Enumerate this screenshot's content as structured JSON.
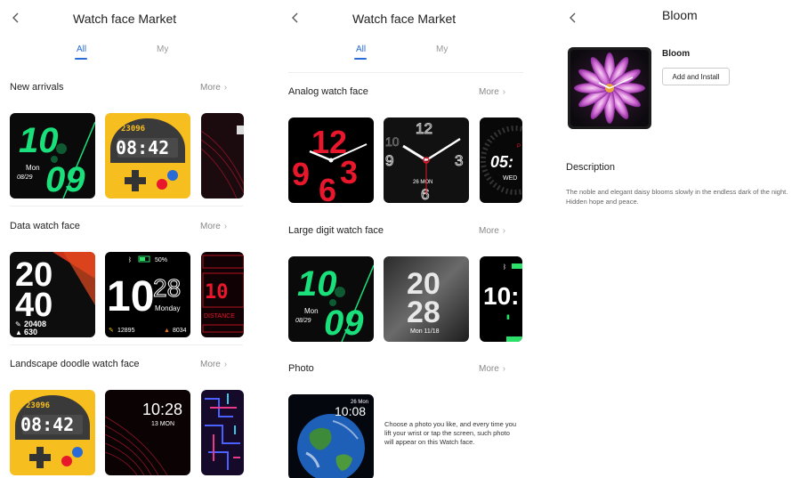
{
  "market": {
    "title": "Watch face Market",
    "tabs": [
      "All",
      "My"
    ]
  },
  "panel1": {
    "sections": [
      {
        "title": "New arrivals",
        "more": "More"
      },
      {
        "title": "Data watch face",
        "more": "More"
      },
      {
        "title": "Landscape doodle watch face",
        "more": "More"
      }
    ],
    "faces": {
      "green_digits": {
        "hour": "10",
        "min": "09",
        "day": "Mon",
        "date": "08/29"
      },
      "yellow_game": {
        "steps": "23096",
        "time": "08:42"
      },
      "white_bold": {
        "top": "20",
        "bottom": "40",
        "steps": "20408",
        "kcal": "630"
      },
      "black_data": {
        "battery": "50%",
        "hour": "10",
        "min": "28",
        "day": "Monday",
        "steps": "12895",
        "kcal": "8034"
      },
      "red_data": {
        "hour": "10",
        "label": "DISTANCE"
      },
      "red_lines": {
        "time": "10:28",
        "date": "13 MON"
      }
    }
  },
  "panel2": {
    "sections": [
      {
        "title": "Analog watch face",
        "more": "More"
      },
      {
        "title": "Large digit watch face",
        "more": "More"
      },
      {
        "title": "Photo",
        "more": "More"
      }
    ],
    "faces": {
      "red_analog": {
        "n12": "12",
        "n9": "9",
        "n6": "6",
        "n3": "3"
      },
      "black_analog": {
        "n12": "12",
        "n3": "3",
        "n6": "6",
        "n9": "9",
        "n10": "10",
        "date": "26 MON"
      },
      "partial_digital": {
        "time": "05:",
        "day": "WED"
      },
      "gray_digits": {
        "top": "20",
        "bottom": "28",
        "date": "Mon 11/18"
      },
      "partial_black": {
        "time": "10:"
      },
      "photo": {
        "date": "26 Mon",
        "time": "10:08"
      }
    },
    "photo_text": "Choose a photo you like, and every time you lift your wrist or tap the screen, such photo will appear on this Watch face."
  },
  "detail": {
    "title": "Bloom",
    "name": "Bloom",
    "install_label": "Add and Install",
    "description_title": "Description",
    "description": "The noble and elegant daisy blooms slowly in the endless dark of the night. Hidden hope and peace."
  },
  "colors": {
    "accent": "#2a6bd8",
    "neon_green": "#19e07a",
    "game_yellow": "#f6be1f",
    "red": "#e8172c"
  },
  "icons": [
    "back-arrow-icon",
    "chevron-right-icon",
    "footsteps-icon",
    "battery-icon",
    "bluetooth-icon",
    "flame-icon"
  ]
}
